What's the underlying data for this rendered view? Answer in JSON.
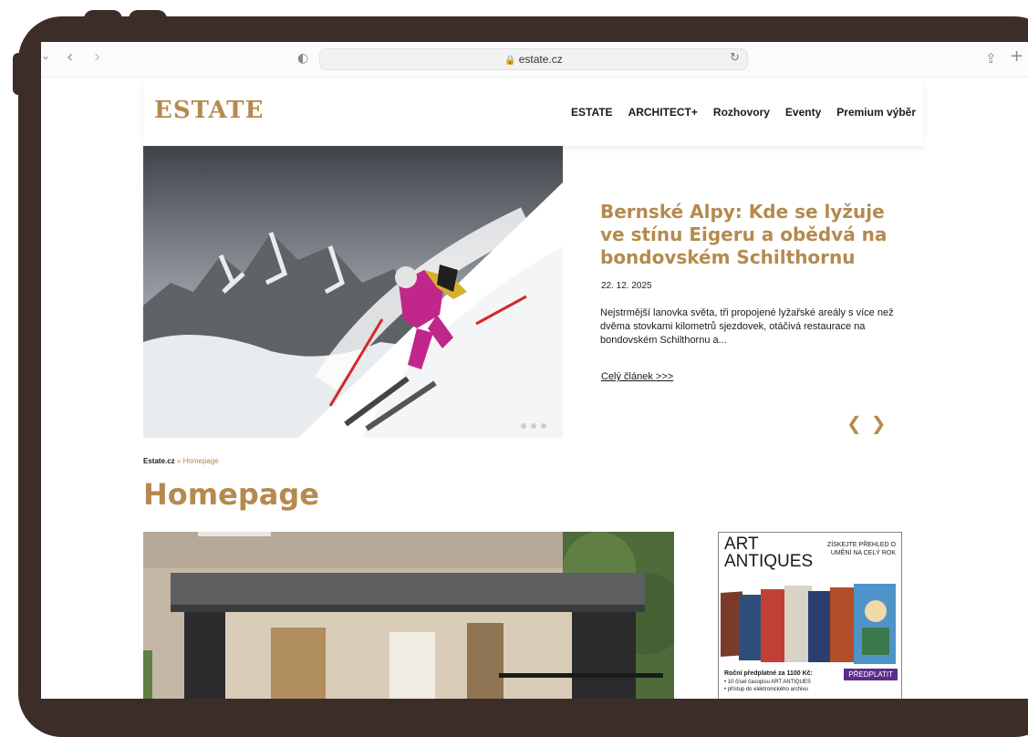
{
  "browser": {
    "url": "estate.cz",
    "back_glyph": "‹",
    "forward_glyph": "›",
    "chevron_glyph": "⌄",
    "privacy_glyph": "◐",
    "lock_glyph": "🔒",
    "reload_glyph": "↻",
    "share_glyph": "⇪",
    "new_tab_glyph": "+"
  },
  "site": {
    "logo": "ESTATE",
    "nav": [
      "ESTATE",
      "ARCHITECT+",
      "Rozhovory",
      "Eventy",
      "Premium výběr"
    ]
  },
  "hero": {
    "title": "Bernské Alpy: Kde se lyžuje ve stínu Eigeru a obědvá na bondovském Schilthornu",
    "date": "22. 12. 2025",
    "excerpt": "Nejstrmější lanovka světa, tři propojené lyžařské areály s více než dvěma stovkami kilometrů sjezdovek, otáčivá restaurace na bondovském Schilthornu a...",
    "link": "Celý článek >>>",
    "prev": "❮",
    "next": "❯"
  },
  "breadcrumb": {
    "home": "Estate.cz",
    "separator": "»",
    "current": "Homepage"
  },
  "page_title": "Homepage",
  "ad": {
    "title_line1": "ART",
    "title_line2": "ANTIQUES",
    "tagline": "ZÍSKEJTE PŘEHLED O UMĚNÍ NA CELÝ ROK",
    "price": "Roční předplatné za 1100 Kč:",
    "bullets": [
      "10 čísel časopisu ART ANTIQUES",
      "přístup do elektronického archivu"
    ],
    "button": "PŘEDPLATIT"
  },
  "colors": {
    "accent": "#b58a4e",
    "frame": "#3d2d28",
    "ad_button": "#5b2d8a"
  }
}
